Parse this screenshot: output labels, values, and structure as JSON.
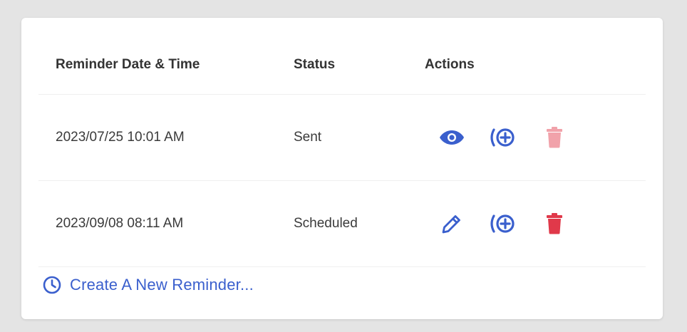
{
  "table": {
    "headers": {
      "date": "Reminder Date & Time",
      "status": "Status",
      "actions": "Actions"
    },
    "rows": [
      {
        "datetime": "2023/07/25 10:01 AM",
        "status": "Sent",
        "actions": [
          "eye-icon",
          "add-broadcast-icon",
          "trash-icon-disabled"
        ]
      },
      {
        "datetime": "2023/09/08 08:11 AM",
        "status": "Scheduled",
        "actions": [
          "pencil-icon",
          "add-broadcast-icon",
          "trash-icon"
        ]
      }
    ]
  },
  "create_link": {
    "label": "Create A New Reminder...",
    "icon": "clock-icon"
  },
  "colors": {
    "accent_blue": "#3a5fcd",
    "delete_red": "#e0394a",
    "delete_disabled": "#f1a2aa"
  }
}
